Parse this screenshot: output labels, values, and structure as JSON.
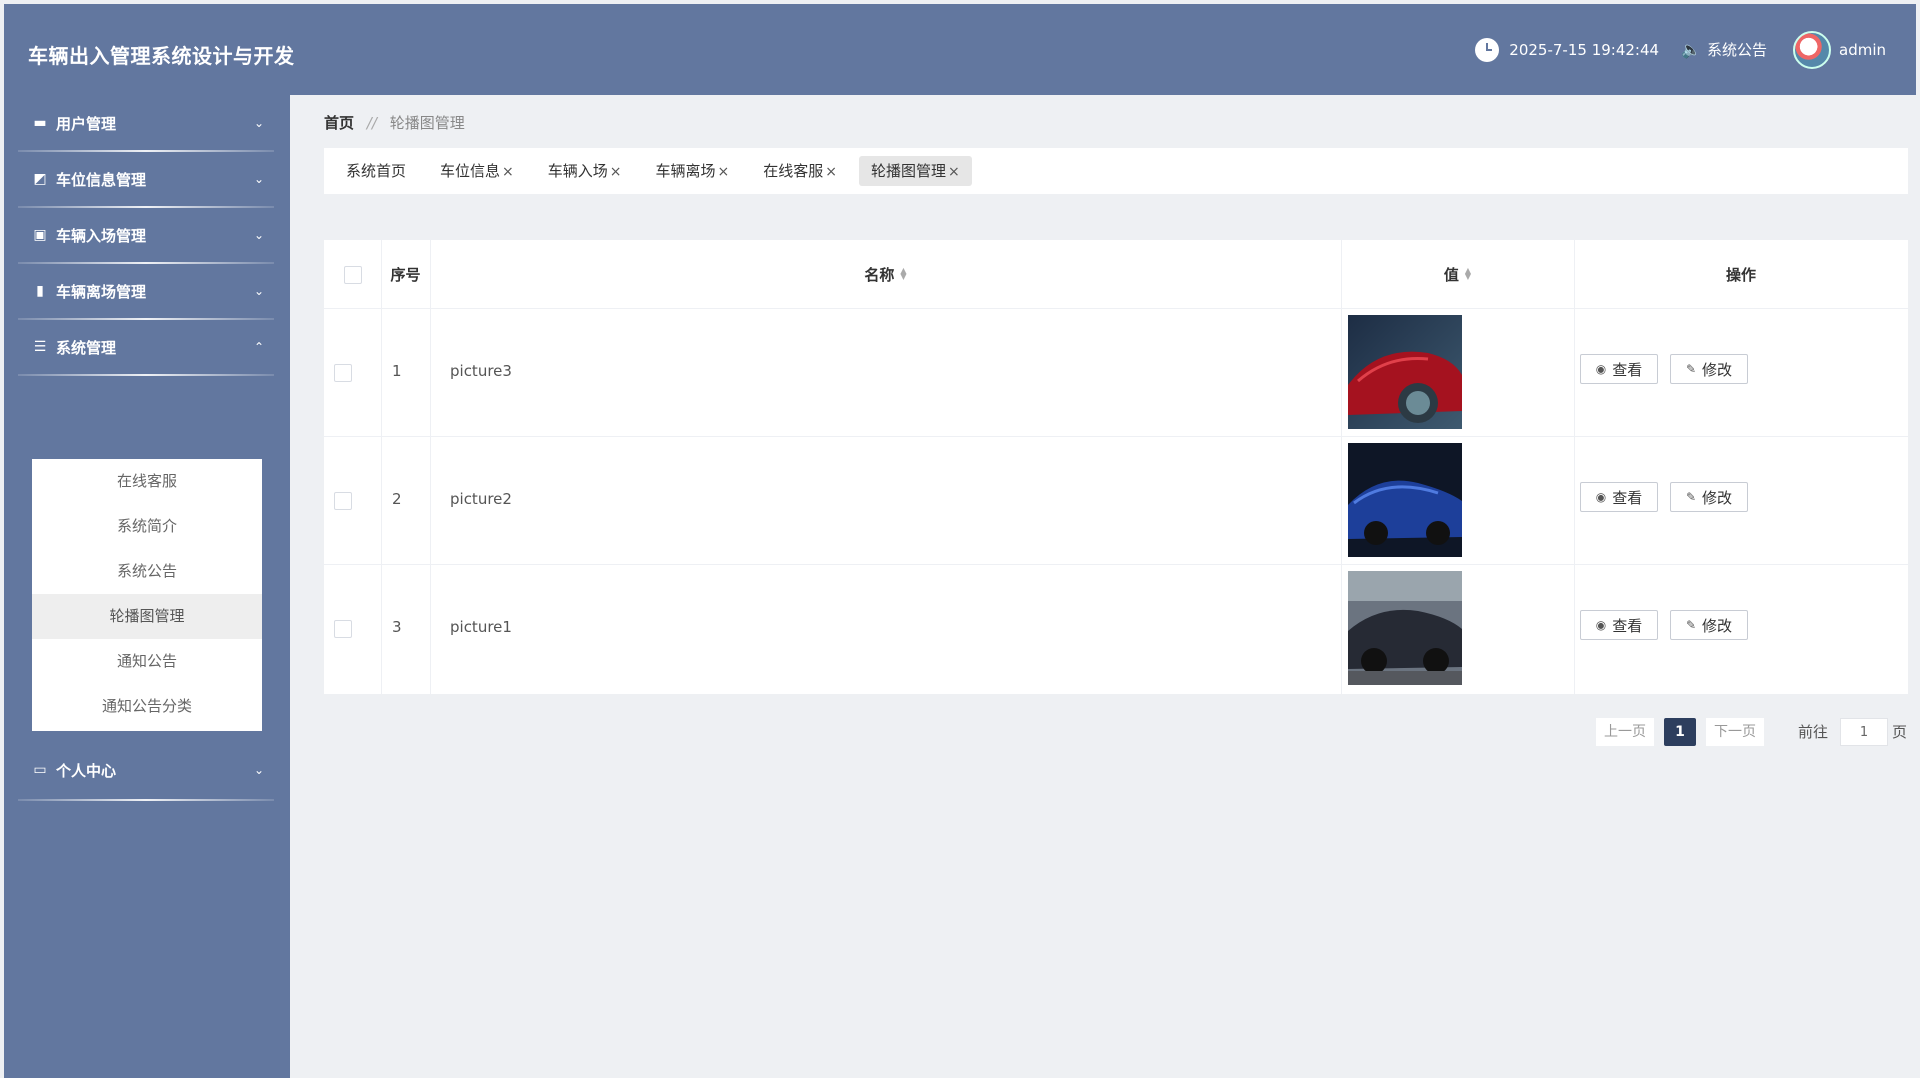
{
  "header": {
    "title": "车辆出入管理系统设计与开发",
    "datetime": "2025-7-15 19:42:44",
    "notice_label": "系统公告",
    "username": "admin"
  },
  "sidebar": {
    "menu": [
      {
        "label": "用户管理",
        "icon": "briefcase-icon",
        "arrow": "⌄"
      },
      {
        "label": "车位信息管理",
        "icon": "chart-icon",
        "arrow": "⌄"
      },
      {
        "label": "车辆入场管理",
        "icon": "clipboard-icon",
        "arrow": "⌄"
      },
      {
        "label": "车辆离场管理",
        "icon": "bars-icon",
        "arrow": "⌄"
      },
      {
        "label": "系统管理",
        "icon": "sliders-icon",
        "arrow": "⌃"
      },
      {
        "label": "个人中心",
        "icon": "card-icon",
        "arrow": "⌄"
      }
    ],
    "submenu": [
      "在线客服",
      "系统简介",
      "系统公告",
      "轮播图管理",
      "通知公告",
      "通知公告分类"
    ]
  },
  "breadcrumb": {
    "home": "首页",
    "separator": "//",
    "current": "轮播图管理"
  },
  "tabs": [
    {
      "label": "系统首页",
      "closable": ""
    },
    {
      "label": "车位信息",
      "closable": "×"
    },
    {
      "label": "车辆入场",
      "closable": "×"
    },
    {
      "label": "车辆离场",
      "closable": "×"
    },
    {
      "label": "在线客服",
      "closable": "×"
    },
    {
      "label": "轮播图管理",
      "closable": "×"
    }
  ],
  "table": {
    "headers": {
      "index": "序号",
      "name": "名称",
      "value": "值",
      "actions": "操作"
    },
    "rows": [
      {
        "index": "1",
        "name": "picture3",
        "image": "red-sports-car"
      },
      {
        "index": "2",
        "name": "picture2",
        "image": "blue-sports-car"
      },
      {
        "index": "3",
        "name": "picture1",
        "image": "dark-sports-car"
      }
    ],
    "view_label": "查看",
    "edit_label": "修改"
  },
  "pagination": {
    "prev": "上一页",
    "current": "1",
    "next": "下一页",
    "goto_prefix": "前往",
    "goto_value": "1",
    "goto_suffix": "页"
  },
  "colors": {
    "header_bg": "#62779f",
    "sidebar_bg": "#62779f",
    "page_bg": "#eef0f3",
    "pager_active": "#2d3e5e"
  }
}
